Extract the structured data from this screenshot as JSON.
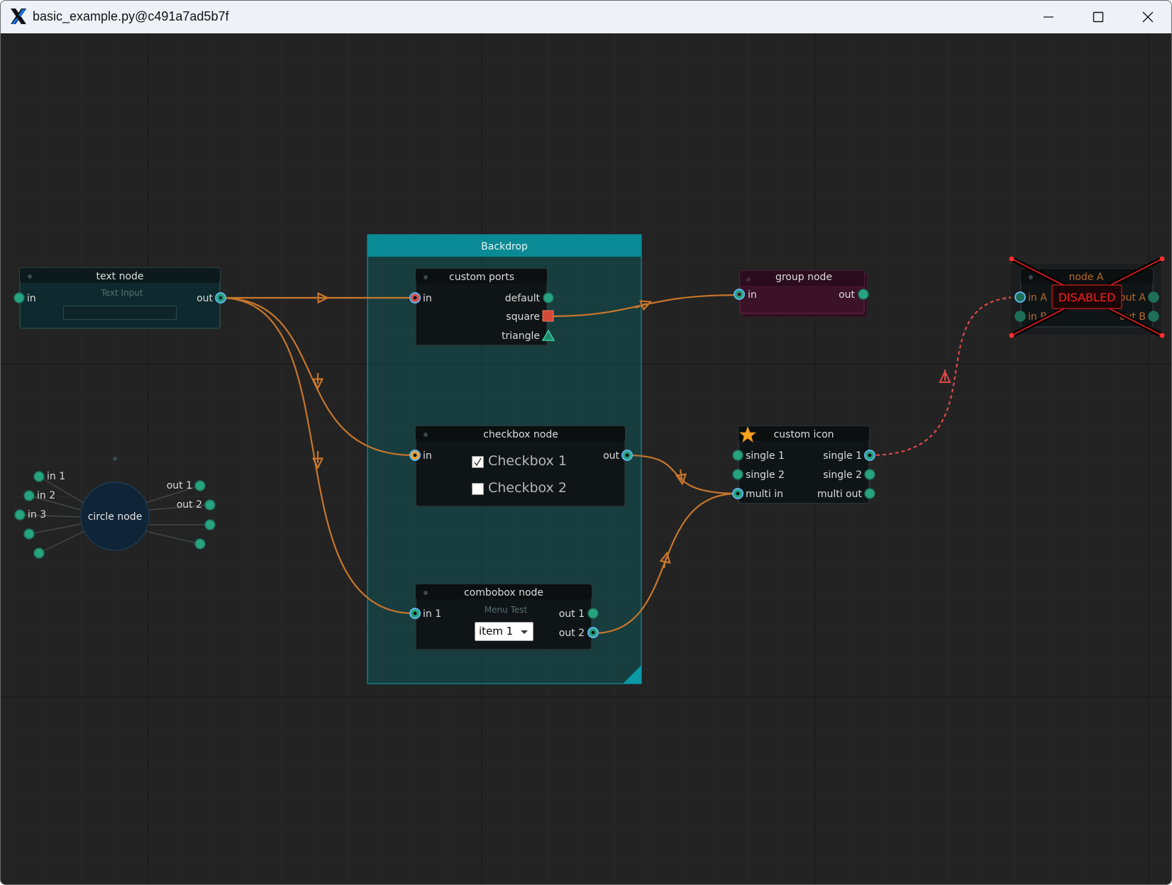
{
  "window": {
    "title": "basic_example.py@c491a7ad5b7f"
  },
  "backdrop": {
    "title": "Backdrop"
  },
  "nodes": {
    "text_node": {
      "title": "text node",
      "in": "in",
      "out": "out",
      "widget_label": "Text Input",
      "input_value": ""
    },
    "custom_ports": {
      "title": "custom ports",
      "in": "in",
      "default": "default",
      "square": "square",
      "triangle": "triangle"
    },
    "group_node": {
      "title": "group node",
      "in": "in",
      "out": "out"
    },
    "node_a": {
      "title": "node A",
      "in_a": "in A",
      "in_b": "in B",
      "out_a": "out A",
      "out_b": "out B",
      "disabled_label": "DISABLED"
    },
    "checkbox_node": {
      "title": "checkbox node",
      "in": "in",
      "out": "out",
      "checkbox1": "Checkbox 1",
      "checkbox2": "Checkbox 2",
      "checkbox1_checked": true,
      "checkbox2_checked": false
    },
    "custom_icon": {
      "title": "custom icon",
      "icon": "star-icon",
      "single1_in": "single 1",
      "single2_in": "single 2",
      "multi_in": "multi in",
      "single1_out": "single 1",
      "single2_out": "single 2",
      "multi_out": "multi out"
    },
    "combobox_node": {
      "title": "combobox node",
      "in1": "in 1",
      "out1": "out 1",
      "out2": "out 2",
      "menu_label": "Menu Test",
      "selected": "item 1"
    },
    "circle_node": {
      "title": "circle node",
      "in1": "in 1",
      "in2": "in 2",
      "in3": "in 3",
      "out1": "out 1",
      "out2": "out 2"
    }
  },
  "colors": {
    "pipe": "#c8762a",
    "pipe_disabled": "#e04848",
    "port": "#26a37f",
    "port_connected_ring": "#5fb3e6",
    "backdrop": "#0a7f88",
    "disabled": "#ff1c1c"
  }
}
